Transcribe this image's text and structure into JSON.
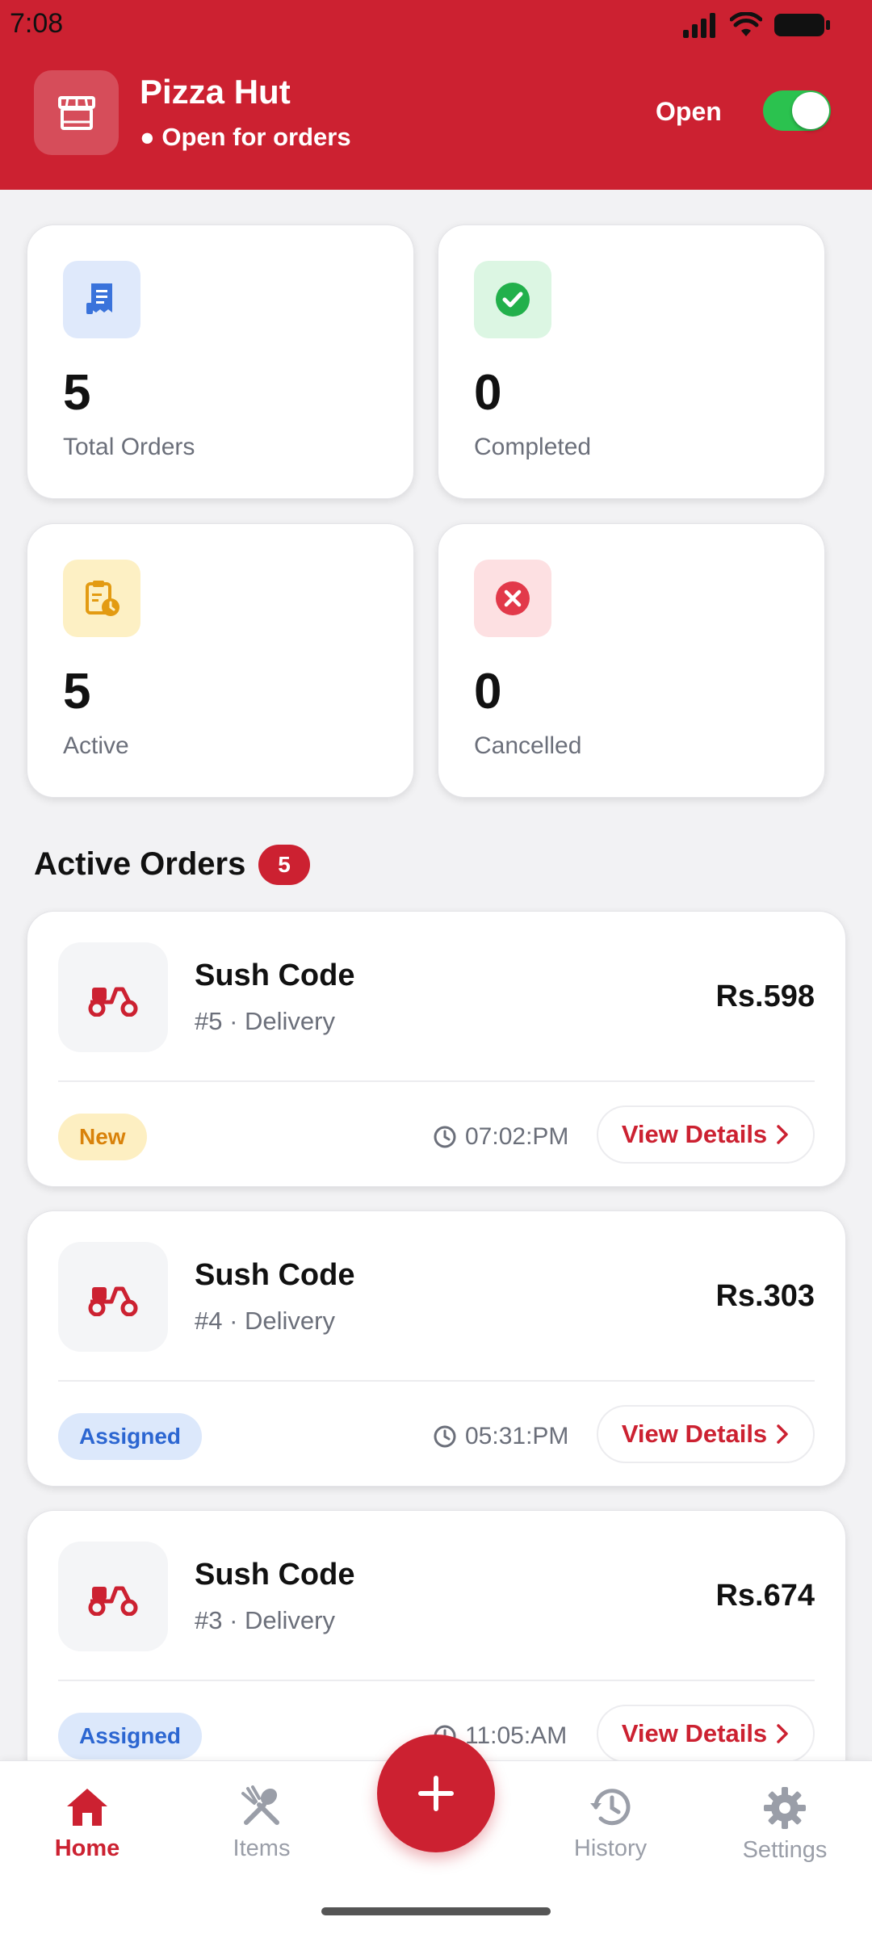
{
  "status_bar": {
    "time": "7:08"
  },
  "header": {
    "store_name": "Pizza Hut",
    "store_status": "● Open for orders",
    "open_label": "Open",
    "toggle_on": true,
    "color": "#cc2131"
  },
  "stats": [
    {
      "value": "5",
      "label": "Total Orders",
      "icon": "receipt-icon",
      "icon_bg": "#dfe9fb",
      "icon_color": "#3a73db"
    },
    {
      "value": "0",
      "label": "Completed",
      "icon": "check-circle-icon",
      "icon_bg": "#dcf6e3",
      "icon_color": "#22b04b"
    },
    {
      "value": "5",
      "label": "Active",
      "icon": "clipboard-clock-icon",
      "icon_bg": "#fdf0c4",
      "icon_color": "#e39b12"
    },
    {
      "value": "0",
      "label": "Cancelled",
      "icon": "x-circle-icon",
      "icon_bg": "#fde0e2",
      "icon_color": "#e2394a"
    }
  ],
  "active_orders": {
    "title": "Active Orders",
    "count": "5",
    "orders": [
      {
        "name": "Sush Code",
        "sub": "#5 · Delivery",
        "price": "Rs.598",
        "status": "New",
        "time": "07:02:PM",
        "action": "View Details"
      },
      {
        "name": "Sush Code",
        "sub": "#4 · Delivery",
        "price": "Rs.303",
        "status": "Assigned",
        "time": "05:31:PM",
        "action": "View Details"
      },
      {
        "name": "Sush Code",
        "sub": "#3 · Delivery",
        "price": "Rs.674",
        "status": "Assigned",
        "time": "11:05:AM",
        "action": "View Details"
      }
    ]
  },
  "bottom_nav": {
    "items": [
      {
        "label": "Home",
        "icon": "home-icon",
        "active": true
      },
      {
        "label": "Items",
        "icon": "utensils-icon",
        "active": false
      },
      {
        "label": "History",
        "icon": "history-icon",
        "active": false
      },
      {
        "label": "Settings",
        "icon": "gear-icon",
        "active": false
      }
    ],
    "fab_icon": "plus-icon"
  }
}
